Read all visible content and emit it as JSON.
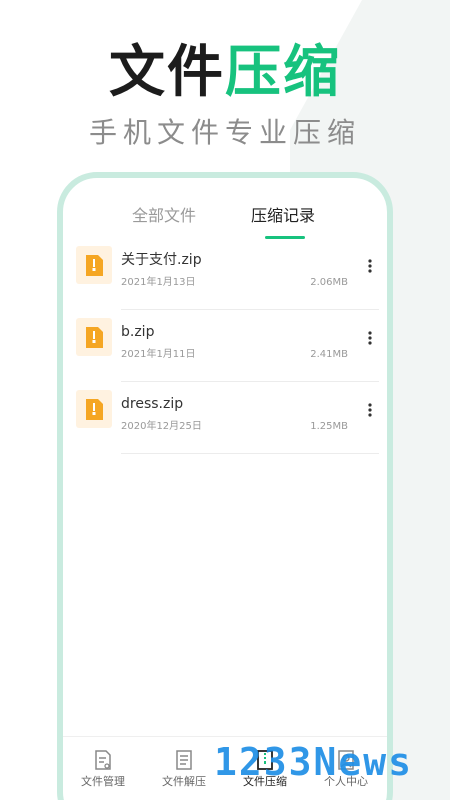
{
  "headline": {
    "part1": "文件",
    "part2": "压缩"
  },
  "subline": "手机文件专业压缩",
  "tabs": [
    {
      "label": "全部文件",
      "active": false
    },
    {
      "label": "压缩记录",
      "active": true
    }
  ],
  "files": [
    {
      "name": "关于支付.zip",
      "date": "2021年1月13日",
      "size": "2.06MB"
    },
    {
      "name": "b.zip",
      "date": "2021年1月11日",
      "size": "2.41MB"
    },
    {
      "name": "dress.zip",
      "date": "2020年12月25日",
      "size": "1.25MB"
    }
  ],
  "bottom_nav": [
    {
      "label": "文件管理",
      "icon": "file-manage-icon",
      "active": false
    },
    {
      "label": "文件解压",
      "icon": "file-extract-icon",
      "active": false
    },
    {
      "label": "文件压缩",
      "icon": "file-compress-icon",
      "active": true
    },
    {
      "label": "个人中心",
      "icon": "profile-icon",
      "active": false
    }
  ],
  "watermark": "1233News",
  "colors": {
    "accent": "#17c27e",
    "phone_border": "#c9ebdf",
    "file_icon_bg": "#fff2e0",
    "file_icon": "#f5a623",
    "watermark": "#1f8fe6"
  }
}
